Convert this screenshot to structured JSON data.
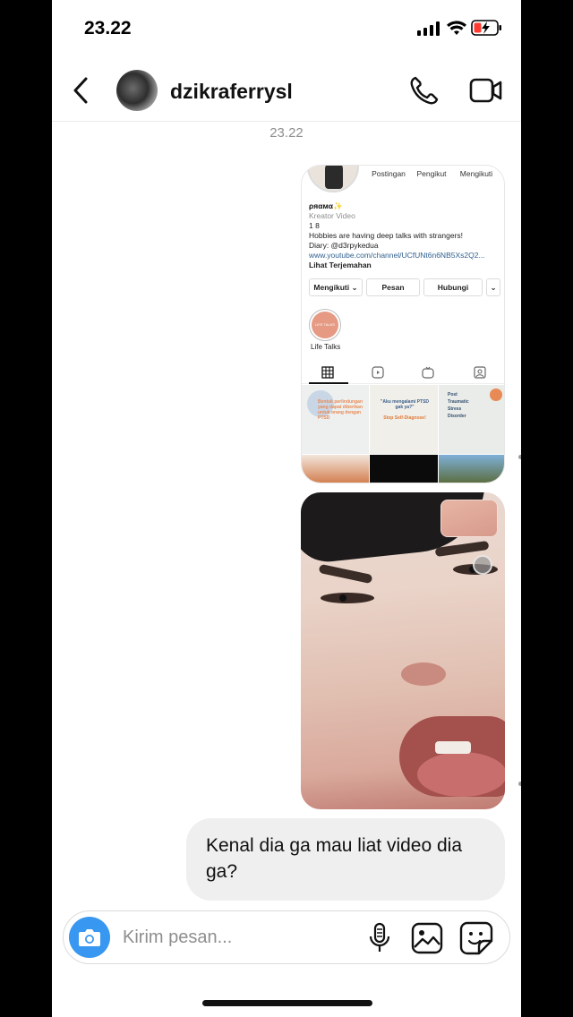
{
  "status_bar": {
    "time": "23.22"
  },
  "header": {
    "username": "dzikraferrysl",
    "back_icon": "chevron-left-icon",
    "call_icon": "phone-icon",
    "video_icon": "video-camera-icon"
  },
  "thread": {
    "timestamp": "23.22"
  },
  "shared_profile": {
    "stats": [
      "Postingan",
      "Pengikut",
      "Mengikuti"
    ],
    "name": "ρяαмα✨",
    "category": "Kreator Video",
    "line1": "1 8",
    "bio": "Hobbies are having deep talks with strangers!",
    "diary": "Diary: @d3rpykedua",
    "link": "www.youtube.com/channel/UCfUNt6n6NB5Xs2Q2...",
    "translate": "Lihat Terjemahan",
    "buttons": {
      "following": "Mengikuti",
      "message": "Pesan",
      "contact": "Hubungi"
    },
    "highlight_label": "Life Talks",
    "highlight_cover": "LIFE TALKS",
    "posts": {
      "post1": "Bentuk perlindungan yang dapat diberikan untuk orang dengan PTSD",
      "post2_quote": "\"Aku mengalami PTSD gak ya?\"",
      "post2_cta": "Stop Self-Diagnose!",
      "post3_lines": [
        "Post",
        "Traumatic",
        "Stress",
        "Disorder"
      ]
    }
  },
  "message": {
    "text": "Kenal dia ga mau liat video dia ga?"
  },
  "composer": {
    "placeholder": "Kirim pesan..."
  },
  "colors": {
    "accent": "#3897f0",
    "bubble": "#efefef"
  }
}
